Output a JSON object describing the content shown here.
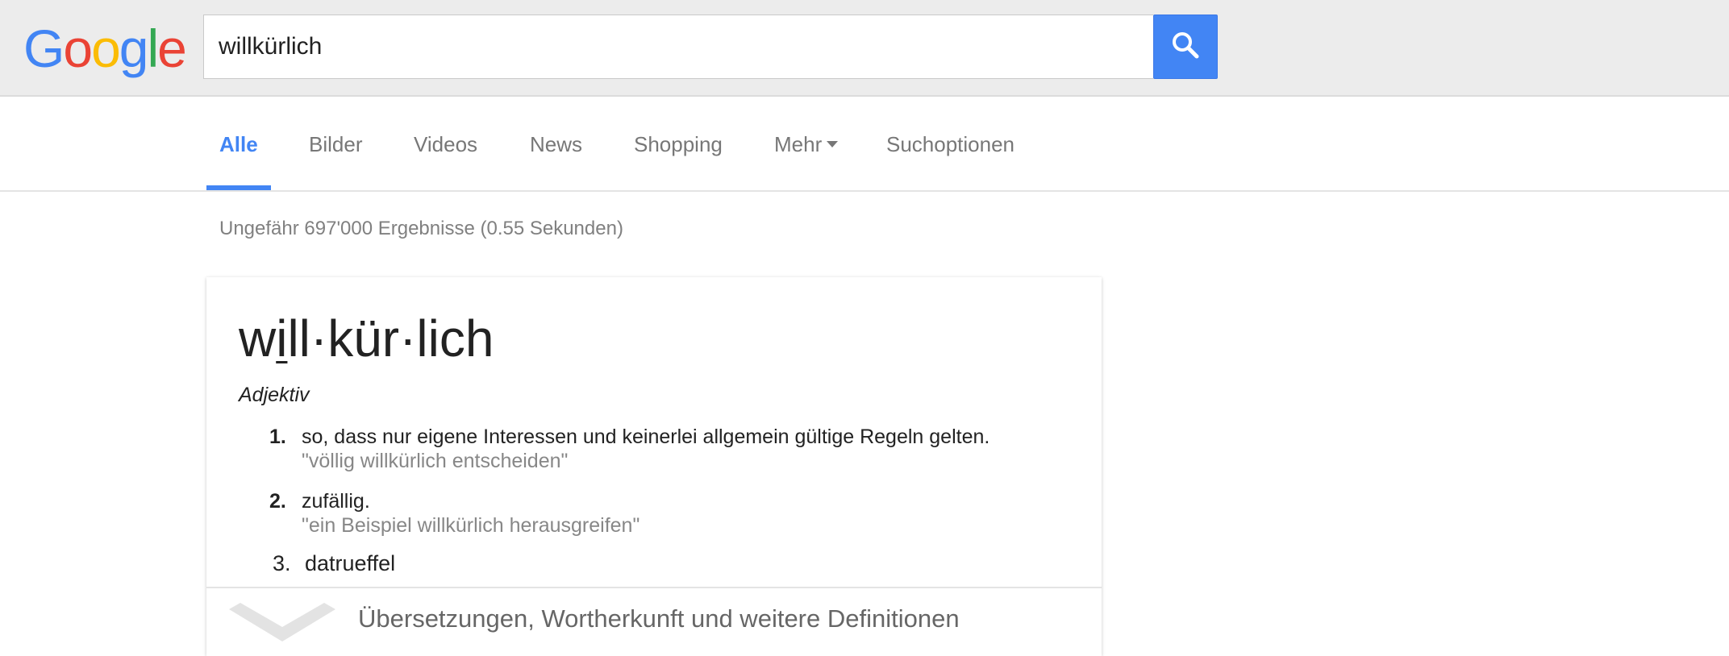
{
  "header": {
    "logo_letters": [
      {
        "ch": "G",
        "color": "#4285f4"
      },
      {
        "ch": "o",
        "color": "#ea4335"
      },
      {
        "ch": "o",
        "color": "#fbbc05"
      },
      {
        "ch": "g",
        "color": "#4285f4"
      },
      {
        "ch": "l",
        "color": "#34a853"
      },
      {
        "ch": "e",
        "color": "#ea4335"
      }
    ],
    "search_value": "willkürlich",
    "search_icon": "search-icon",
    "accent": "#4285f4"
  },
  "nav": {
    "tabs": [
      {
        "label": "Alle",
        "active": true
      },
      {
        "label": "Bilder"
      },
      {
        "label": "Videos"
      },
      {
        "label": "News"
      },
      {
        "label": "Shopping"
      },
      {
        "label": "Mehr"
      },
      {
        "label": "Suchoptionen"
      }
    ]
  },
  "results": {
    "stats": "Ungefähr 697'000 Ergebnisse (0.55 Sekunden)"
  },
  "dictionary": {
    "headword_parts": [
      "w",
      "i",
      "ll·kür·lich"
    ],
    "part_of_speech": "Adjektiv",
    "definitions": [
      {
        "num": "1.",
        "text": "so, dass nur eigene Interessen und keinerlei allgemein gültige Regeln gelten.",
        "example": "\"völlig willkürlich entscheiden\""
      },
      {
        "num": "2.",
        "text": "zufällig.",
        "example": "\"ein Beispiel willkürlich herausgreifen\""
      },
      {
        "num": "3.",
        "text": "datrueffel"
      }
    ],
    "more_label": "Übersetzungen, Wortherkunft und weitere Definitionen"
  }
}
